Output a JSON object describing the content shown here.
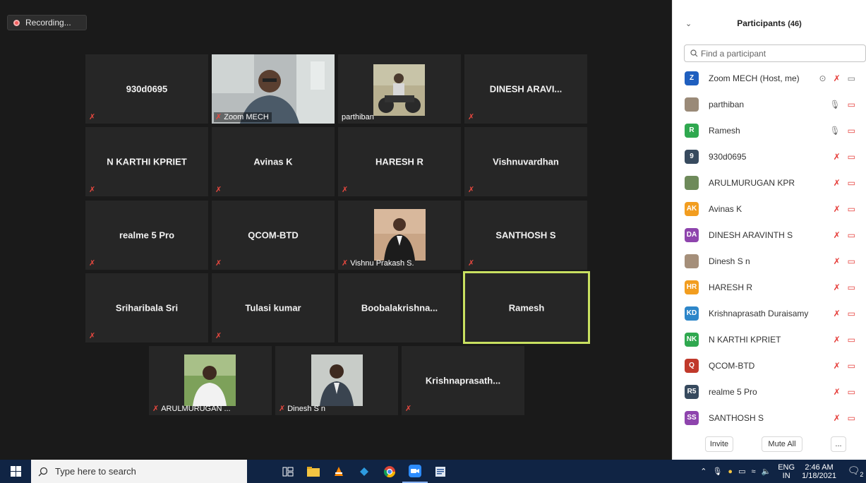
{
  "recording": {
    "label": "Recording..."
  },
  "tiles": [
    {
      "name": "930d0695",
      "footer": ""
    },
    {
      "name": "",
      "footer": "Zoom MECH"
    },
    {
      "name": "",
      "footer": "parthiban"
    },
    {
      "name": "DINESH ARAVI...",
      "footer": ""
    },
    {
      "name": "N KARTHI KPRIET",
      "footer": ""
    },
    {
      "name": "Avinas K",
      "footer": ""
    },
    {
      "name": "HARESH R",
      "footer": ""
    },
    {
      "name": "Vishnuvardhan",
      "footer": ""
    },
    {
      "name": "realme 5 Pro",
      "footer": ""
    },
    {
      "name": "QCOM-BTD",
      "footer": ""
    },
    {
      "name": "",
      "footer": "Vishnu Prakash S."
    },
    {
      "name": "SANTHOSH S",
      "footer": ""
    },
    {
      "name": "Sriharibala Sri",
      "footer": ""
    },
    {
      "name": "Tulasi kumar",
      "footer": ""
    },
    {
      "name": "Boobalakrishna...",
      "footer": ""
    },
    {
      "name": "Ramesh",
      "footer": ""
    },
    {
      "name": "",
      "footer": "ARULMURUGAN ..."
    },
    {
      "name": "",
      "footer": "Dinesh S n"
    },
    {
      "name": "Krishnaprasath...",
      "footer": ""
    }
  ],
  "panel": {
    "title": "Participants",
    "count": "(46)",
    "search_placeholder": "Find a participant",
    "participants": [
      {
        "initials": "Z",
        "name": "Zoom MECH (Host, me)",
        "color": "#1f5fbf"
      },
      {
        "initials": "",
        "name": "parthiban",
        "color": "#9a8a78"
      },
      {
        "initials": "R",
        "name": "Ramesh",
        "color": "#2fa84f"
      },
      {
        "initials": "9",
        "name": "930d0695",
        "color": "#374a5e"
      },
      {
        "initials": "",
        "name": "ARULMURUGAN KPR",
        "color": "#6e8a5a"
      },
      {
        "initials": "AK",
        "name": "Avinas K",
        "color": "#f29d1f"
      },
      {
        "initials": "DA",
        "name": "DINESH ARAVINTH S",
        "color": "#8e44ad"
      },
      {
        "initials": "",
        "name": "Dinesh S n",
        "color": "#a58f7a"
      },
      {
        "initials": "HR",
        "name": "HARESH R",
        "color": "#f29d1f"
      },
      {
        "initials": "KD",
        "name": "Krishnaprasath Duraisamy",
        "color": "#2d86c9"
      },
      {
        "initials": "NK",
        "name": "N KARTHI KPRIET",
        "color": "#2fa84f"
      },
      {
        "initials": "Q",
        "name": "QCOM-BTD",
        "color": "#c0392b"
      },
      {
        "initials": "R5",
        "name": "realme 5 Pro",
        "color": "#374a5e"
      },
      {
        "initials": "SS",
        "name": "SANTHOSH S",
        "color": "#8e44ad"
      }
    ],
    "invite_label": "Invite",
    "mute_all_label": "Mute All",
    "more_label": "..."
  },
  "taskbar": {
    "search_placeholder": "Type here to search",
    "lang_top": "ENG",
    "lang_bottom": "IN",
    "time": "2:46 AM",
    "date": "1/18/2021",
    "notification_count": "2"
  }
}
